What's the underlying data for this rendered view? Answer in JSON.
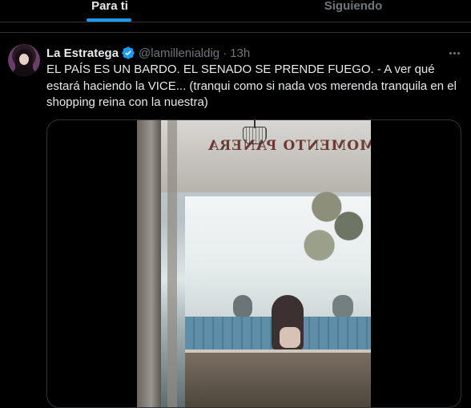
{
  "tabs": [
    {
      "label": "Para ti",
      "active": true
    },
    {
      "label": "Siguiendo",
      "active": false
    }
  ],
  "post": {
    "author_name": "La Estratega",
    "verified": true,
    "handle": "@lamillenialdig",
    "separator": "·",
    "time": "13h",
    "text": "EL PAÍS ES UN BARDO. EL SENADO SE PRENDE FUEGO. - A ver qué estará haciendo la VICE... (tranqui como si nada vos merenda tranquila en el shopping reina con la nuestra)",
    "media": {
      "type": "photo",
      "visible_sign_text": "MOMENTO PANERA"
    }
  },
  "icons": {
    "verified": "verified-badge-icon",
    "more": "more-horizontal-icon"
  },
  "colors": {
    "accent": "#1d9bf0",
    "text_primary": "#e7e9ea",
    "text_secondary": "#71767b",
    "border": "#2f3336",
    "background": "#000000"
  }
}
